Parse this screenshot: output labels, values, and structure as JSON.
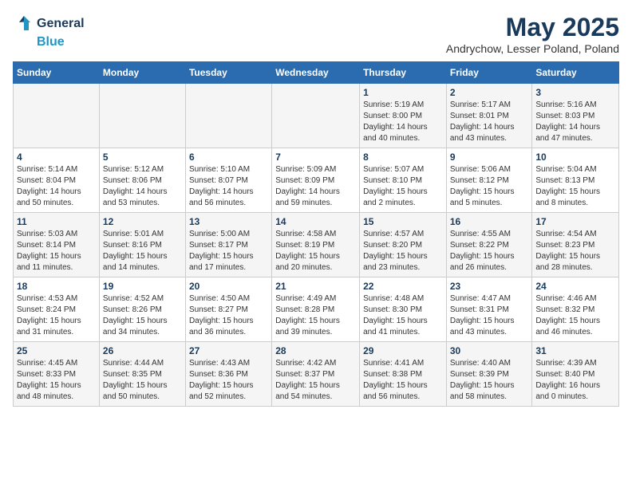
{
  "header": {
    "logo_line1": "General",
    "logo_line2": "Blue",
    "month_year": "May 2025",
    "location": "Andrychow, Lesser Poland, Poland"
  },
  "weekdays": [
    "Sunday",
    "Monday",
    "Tuesday",
    "Wednesday",
    "Thursday",
    "Friday",
    "Saturday"
  ],
  "weeks": [
    [
      {
        "day": "",
        "info": ""
      },
      {
        "day": "",
        "info": ""
      },
      {
        "day": "",
        "info": ""
      },
      {
        "day": "",
        "info": ""
      },
      {
        "day": "1",
        "info": "Sunrise: 5:19 AM\nSunset: 8:00 PM\nDaylight: 14 hours\nand 40 minutes."
      },
      {
        "day": "2",
        "info": "Sunrise: 5:17 AM\nSunset: 8:01 PM\nDaylight: 14 hours\nand 43 minutes."
      },
      {
        "day": "3",
        "info": "Sunrise: 5:16 AM\nSunset: 8:03 PM\nDaylight: 14 hours\nand 47 minutes."
      }
    ],
    [
      {
        "day": "4",
        "info": "Sunrise: 5:14 AM\nSunset: 8:04 PM\nDaylight: 14 hours\nand 50 minutes."
      },
      {
        "day": "5",
        "info": "Sunrise: 5:12 AM\nSunset: 8:06 PM\nDaylight: 14 hours\nand 53 minutes."
      },
      {
        "day": "6",
        "info": "Sunrise: 5:10 AM\nSunset: 8:07 PM\nDaylight: 14 hours\nand 56 minutes."
      },
      {
        "day": "7",
        "info": "Sunrise: 5:09 AM\nSunset: 8:09 PM\nDaylight: 14 hours\nand 59 minutes."
      },
      {
        "day": "8",
        "info": "Sunrise: 5:07 AM\nSunset: 8:10 PM\nDaylight: 15 hours\nand 2 minutes."
      },
      {
        "day": "9",
        "info": "Sunrise: 5:06 AM\nSunset: 8:12 PM\nDaylight: 15 hours\nand 5 minutes."
      },
      {
        "day": "10",
        "info": "Sunrise: 5:04 AM\nSunset: 8:13 PM\nDaylight: 15 hours\nand 8 minutes."
      }
    ],
    [
      {
        "day": "11",
        "info": "Sunrise: 5:03 AM\nSunset: 8:14 PM\nDaylight: 15 hours\nand 11 minutes."
      },
      {
        "day": "12",
        "info": "Sunrise: 5:01 AM\nSunset: 8:16 PM\nDaylight: 15 hours\nand 14 minutes."
      },
      {
        "day": "13",
        "info": "Sunrise: 5:00 AM\nSunset: 8:17 PM\nDaylight: 15 hours\nand 17 minutes."
      },
      {
        "day": "14",
        "info": "Sunrise: 4:58 AM\nSunset: 8:19 PM\nDaylight: 15 hours\nand 20 minutes."
      },
      {
        "day": "15",
        "info": "Sunrise: 4:57 AM\nSunset: 8:20 PM\nDaylight: 15 hours\nand 23 minutes."
      },
      {
        "day": "16",
        "info": "Sunrise: 4:55 AM\nSunset: 8:22 PM\nDaylight: 15 hours\nand 26 minutes."
      },
      {
        "day": "17",
        "info": "Sunrise: 4:54 AM\nSunset: 8:23 PM\nDaylight: 15 hours\nand 28 minutes."
      }
    ],
    [
      {
        "day": "18",
        "info": "Sunrise: 4:53 AM\nSunset: 8:24 PM\nDaylight: 15 hours\nand 31 minutes."
      },
      {
        "day": "19",
        "info": "Sunrise: 4:52 AM\nSunset: 8:26 PM\nDaylight: 15 hours\nand 34 minutes."
      },
      {
        "day": "20",
        "info": "Sunrise: 4:50 AM\nSunset: 8:27 PM\nDaylight: 15 hours\nand 36 minutes."
      },
      {
        "day": "21",
        "info": "Sunrise: 4:49 AM\nSunset: 8:28 PM\nDaylight: 15 hours\nand 39 minutes."
      },
      {
        "day": "22",
        "info": "Sunrise: 4:48 AM\nSunset: 8:30 PM\nDaylight: 15 hours\nand 41 minutes."
      },
      {
        "day": "23",
        "info": "Sunrise: 4:47 AM\nSunset: 8:31 PM\nDaylight: 15 hours\nand 43 minutes."
      },
      {
        "day": "24",
        "info": "Sunrise: 4:46 AM\nSunset: 8:32 PM\nDaylight: 15 hours\nand 46 minutes."
      }
    ],
    [
      {
        "day": "25",
        "info": "Sunrise: 4:45 AM\nSunset: 8:33 PM\nDaylight: 15 hours\nand 48 minutes."
      },
      {
        "day": "26",
        "info": "Sunrise: 4:44 AM\nSunset: 8:35 PM\nDaylight: 15 hours\nand 50 minutes."
      },
      {
        "day": "27",
        "info": "Sunrise: 4:43 AM\nSunset: 8:36 PM\nDaylight: 15 hours\nand 52 minutes."
      },
      {
        "day": "28",
        "info": "Sunrise: 4:42 AM\nSunset: 8:37 PM\nDaylight: 15 hours\nand 54 minutes."
      },
      {
        "day": "29",
        "info": "Sunrise: 4:41 AM\nSunset: 8:38 PM\nDaylight: 15 hours\nand 56 minutes."
      },
      {
        "day": "30",
        "info": "Sunrise: 4:40 AM\nSunset: 8:39 PM\nDaylight: 15 hours\nand 58 minutes."
      },
      {
        "day": "31",
        "info": "Sunrise: 4:39 AM\nSunset: 8:40 PM\nDaylight: 16 hours\nand 0 minutes."
      }
    ]
  ]
}
